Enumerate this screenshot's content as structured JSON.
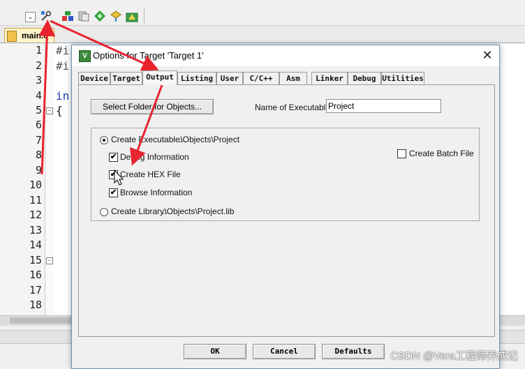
{
  "ide": {
    "file_tab": "main.c",
    "line_numbers": [
      "1",
      "2",
      "3",
      "4",
      "5",
      "6",
      "7",
      "8",
      "9",
      "10",
      "11",
      "12",
      "13",
      "14",
      "15",
      "16",
      "17",
      "18"
    ],
    "code_fragments": {
      "l1": "#i",
      "l2": "#i",
      "l4": "in",
      "l5": "{"
    },
    "toolbar_icons": [
      "dropdown-icon",
      "target-options-icon",
      "manage-components-icon",
      "file-extensions-icon",
      "select-software-packs-icon",
      "pack-installer-icon",
      "run-time-environment-icon"
    ]
  },
  "dialog": {
    "title": "Options for Target 'Target 1'",
    "close": "✕",
    "tabs": [
      "Device",
      "Target",
      "Output",
      "Listing",
      "User",
      "C/C++",
      "Asm",
      "Linker",
      "Debug",
      "Utilities"
    ],
    "active_tab": "Output",
    "select_folder_button": "Select Folder for Objects...",
    "name_of_executable_label": "Name of Executable:",
    "name_of_executable_value": "Project",
    "create_executable": {
      "label": "Create Executable:",
      "path": ".\\Objects\\Project",
      "selected": true
    },
    "debug_information": {
      "label": "Debug Information",
      "checked": true
    },
    "create_hex_file": {
      "label": "Create HEX File",
      "checked": true
    },
    "browse_information": {
      "label": "Browse Information",
      "checked": true
    },
    "create_batch_file": {
      "label": "Create Batch File",
      "checked": false
    },
    "create_library": {
      "label": "Create Library:",
      "path": ".\\Objects\\Project.lib",
      "selected": false
    },
    "footer_buttons": {
      "ok": "OK",
      "cancel": "Cancel",
      "defaults": "Defaults"
    }
  },
  "watermark": "CSDN @Vera工程师养成记",
  "colors": {
    "annotation_arrow": "#e8242f",
    "title_icon": "#3b8a3b",
    "editor_tab": "#fff3c8"
  }
}
